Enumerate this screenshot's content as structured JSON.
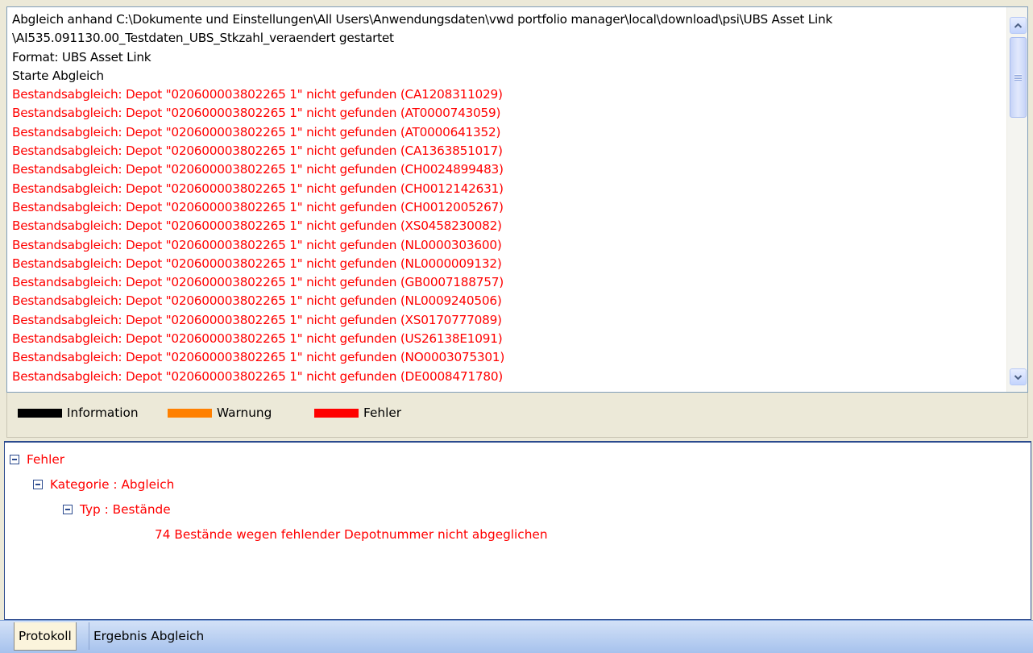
{
  "log": {
    "lines": [
      {
        "text": "Abgleich anhand C:\\Dokumente und Einstellungen\\All Users\\Anwendungsdaten\\vwd portfolio manager\\local\\download\\psi\\UBS Asset Link",
        "level": "info"
      },
      {
        "text": "\\AI535.091130.00_Testdaten_UBS_Stkzahl_veraendert gestartet",
        "level": "info"
      },
      {
        "text": "Format: UBS Asset Link",
        "level": "info"
      },
      {
        "text": "Starte Abgleich",
        "level": "info"
      },
      {
        "text": "Bestandsabgleich: Depot \"020600003802265 1\" nicht gefunden (CA1208311029)",
        "level": "error"
      },
      {
        "text": "Bestandsabgleich: Depot \"020600003802265 1\" nicht gefunden (AT0000743059)",
        "level": "error"
      },
      {
        "text": "Bestandsabgleich: Depot \"020600003802265 1\" nicht gefunden (AT0000641352)",
        "level": "error"
      },
      {
        "text": "Bestandsabgleich: Depot \"020600003802265 1\" nicht gefunden (CA1363851017)",
        "level": "error"
      },
      {
        "text": "Bestandsabgleich: Depot \"020600003802265 1\" nicht gefunden (CH0024899483)",
        "level": "error"
      },
      {
        "text": "Bestandsabgleich: Depot \"020600003802265 1\" nicht gefunden (CH0012142631)",
        "level": "error"
      },
      {
        "text": "Bestandsabgleich: Depot \"020600003802265 1\" nicht gefunden (CH0012005267)",
        "level": "error"
      },
      {
        "text": "Bestandsabgleich: Depot \"020600003802265 1\" nicht gefunden (XS0458230082)",
        "level": "error"
      },
      {
        "text": "Bestandsabgleich: Depot \"020600003802265 1\" nicht gefunden (NL0000303600)",
        "level": "error"
      },
      {
        "text": "Bestandsabgleich: Depot \"020600003802265 1\" nicht gefunden (NL0000009132)",
        "level": "error"
      },
      {
        "text": "Bestandsabgleich: Depot \"020600003802265 1\" nicht gefunden (GB0007188757)",
        "level": "error"
      },
      {
        "text": "Bestandsabgleich: Depot \"020600003802265 1\" nicht gefunden (NL0009240506)",
        "level": "error"
      },
      {
        "text": "Bestandsabgleich: Depot \"020600003802265 1\" nicht gefunden (XS0170777089)",
        "level": "error"
      },
      {
        "text": "Bestandsabgleich: Depot \"020600003802265 1\" nicht gefunden (US26138E1091)",
        "level": "error"
      },
      {
        "text": "Bestandsabgleich: Depot \"020600003802265 1\" nicht gefunden (NO0003075301)",
        "level": "error"
      },
      {
        "text": "Bestandsabgleich: Depot \"020600003802265 1\" nicht gefunden (DE0008471780)",
        "level": "error"
      }
    ]
  },
  "legend": {
    "info": {
      "label": "Information",
      "color": "#000000"
    },
    "warn": {
      "label": "Warnung",
      "color": "#ff8000"
    },
    "error": {
      "label": "Fehler",
      "color": "#ff0000"
    }
  },
  "tree": {
    "root": "Fehler",
    "category": "Kategorie : Abgleich",
    "type": "Typ : Bestände",
    "message": "74 Bestände wegen fehlender Depotnummer nicht abgeglichen"
  },
  "tabs": {
    "protokoll": "Protokoll",
    "ergebnis": "Ergebnis Abgleich",
    "active": "protokoll"
  },
  "icons": {
    "scroll_up": "arrow-up-icon",
    "scroll_down": "arrow-down-icon",
    "collapse": "minus-box-icon"
  }
}
